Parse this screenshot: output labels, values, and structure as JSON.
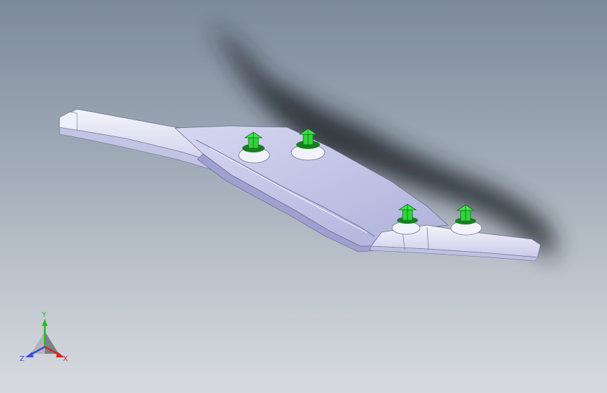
{
  "viewport": {
    "background_top": "#7d8a9b",
    "background_bottom": "#d7dbdf",
    "part_color": "#e6e7f6",
    "part_shade": "#b9bbe0",
    "fastener_color": "#2fd43a",
    "shadow_color": "#1f2226"
  },
  "triad": {
    "y_label": "Y",
    "x_label": "X",
    "z_label": "Z",
    "y_color": "#2ab52a",
    "x_color": "#d02a2a",
    "z_color": "#3a4fd6"
  }
}
